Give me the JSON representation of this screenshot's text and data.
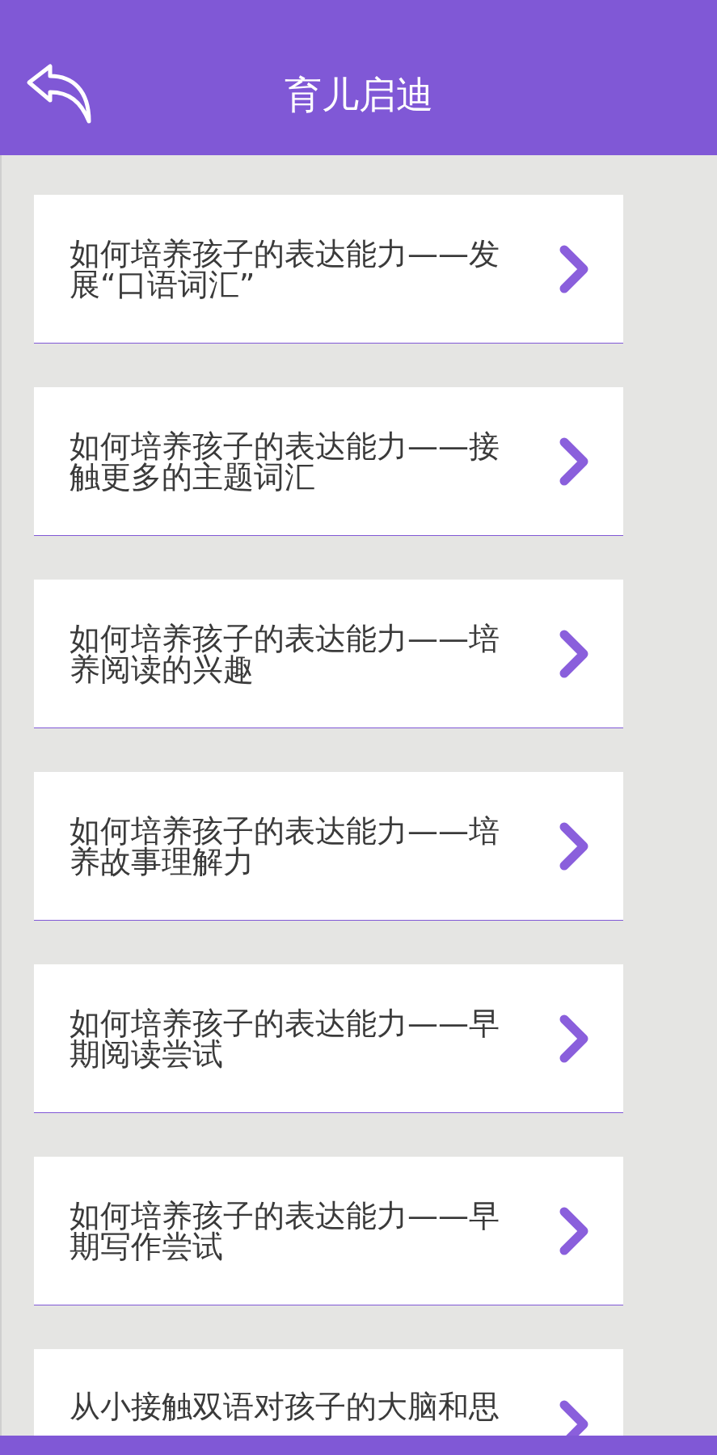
{
  "header": {
    "title": "育儿启迪"
  },
  "articles": [
    {
      "title": "如何培养孩子的表达能力——发展“口语词汇”"
    },
    {
      "title": "如何培养孩子的表达能力——接触更多的主题词汇"
    },
    {
      "title": "如何培养孩子的表达能力——培养阅读的兴趣"
    },
    {
      "title": "如何培养孩子的表达能力——培养故事理解力"
    },
    {
      "title": "如何培养孩子的表达能力——早期阅读尝试"
    },
    {
      "title": "如何培养孩子的表达能力——早期写作尝试"
    },
    {
      "title": "从小接触双语对孩子的大脑和思"
    }
  ]
}
